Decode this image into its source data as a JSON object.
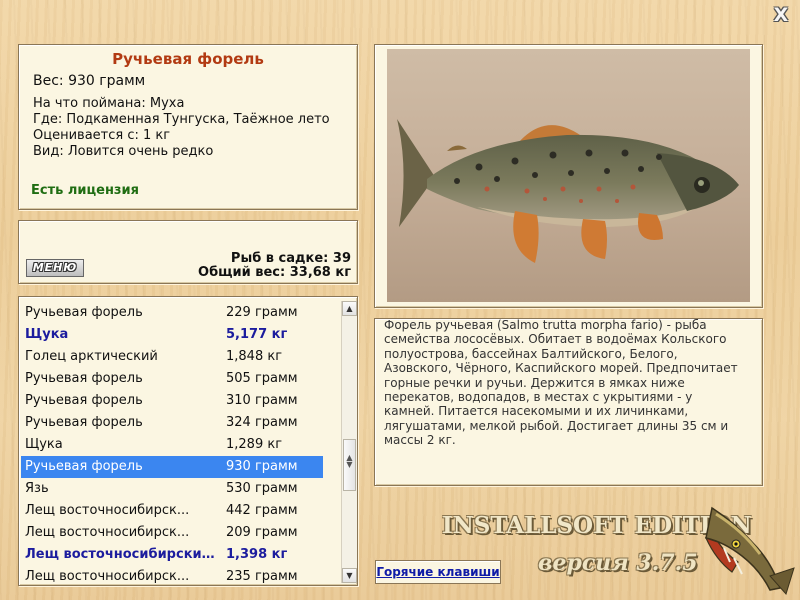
{
  "window": {
    "close_label": "X"
  },
  "fish_info": {
    "name": "Ручьевая форель",
    "weight_line": "Вес: 930 грамм",
    "caught_on": "На что поймана: Муха",
    "where": "Где: Подкаменная Тунгуска, Таёжное лето",
    "rated_from": "Оценивается с: 1 кг",
    "type": "Вид: Ловится очень редко",
    "license": "Есть лицензия"
  },
  "stats": {
    "menu_label": "МЕНЮ",
    "fish_in_net": "Рыб в садке: 39",
    "total_weight": "Общий вес: 33,68 кг"
  },
  "catch_list": [
    {
      "name": "Ручьевая форель",
      "weight": "229 грамм",
      "highlight": false,
      "selected": false
    },
    {
      "name": "Щука",
      "weight": "5,177 кг",
      "highlight": true,
      "selected": false
    },
    {
      "name": "Голец арктический",
      "weight": "1,848 кг",
      "highlight": false,
      "selected": false
    },
    {
      "name": "Ручьевая форель",
      "weight": "505 грамм",
      "highlight": false,
      "selected": false
    },
    {
      "name": "Ручьевая форель",
      "weight": "310 грамм",
      "highlight": false,
      "selected": false
    },
    {
      "name": "Ручьевая форель",
      "weight": "324 грамм",
      "highlight": false,
      "selected": false
    },
    {
      "name": "Щука",
      "weight": "1,289 кг",
      "highlight": false,
      "selected": false
    },
    {
      "name": "Ручьевая форель",
      "weight": "930 грамм",
      "highlight": false,
      "selected": true
    },
    {
      "name": "Язь",
      "weight": "530 грамм",
      "highlight": false,
      "selected": false
    },
    {
      "name": "Лещ восточносибирск...",
      "weight": "442 грамм",
      "highlight": false,
      "selected": false
    },
    {
      "name": "Лещ восточносибирск...",
      "weight": "209 грамм",
      "highlight": false,
      "selected": false
    },
    {
      "name": "Лещ восточносибирски...",
      "weight": "1,398 кг",
      "highlight": true,
      "selected": false
    },
    {
      "name": "Лещ восточносибирск...",
      "weight": "235 грамм",
      "highlight": false,
      "selected": false
    }
  ],
  "description": "Форель ручьевая (Salmo trutta morpha fario) - рыба семейства лососёвых. Обитает в водоёмах Кольского полуострова, бассейнах Балтийского, Белого, Азовского, Чёрного, Каспийского морей. Предпочитает горные речки и ручьи. Держится в ямках ниже перекатов, водопадов, в местах с укрытиями - у камней. Питается насекомыми и их личинками, лягушатами, мелкой рыбой. Достигает длины 35 см и массы 2 кг.",
  "footer": {
    "hotkeys_label": "Горячие клавиши",
    "brand": "INSTALLSOFT EDITION",
    "version": "версия 3.7.5"
  },
  "icons": {
    "close": "close-icon",
    "scroll_up": "scroll-up-arrow-icon",
    "scroll_down": "scroll-down-arrow-icon",
    "scroll_thumb": "scroll-thumb-grip-icon",
    "logo": "pike-logo-icon"
  },
  "colors": {
    "title": "#b23a12",
    "license": "#1f6d12",
    "highlight_row": "#1c1c9e",
    "selected_row_bg": "#3b86f0",
    "hotkeys_link": "#0f1ba8"
  }
}
